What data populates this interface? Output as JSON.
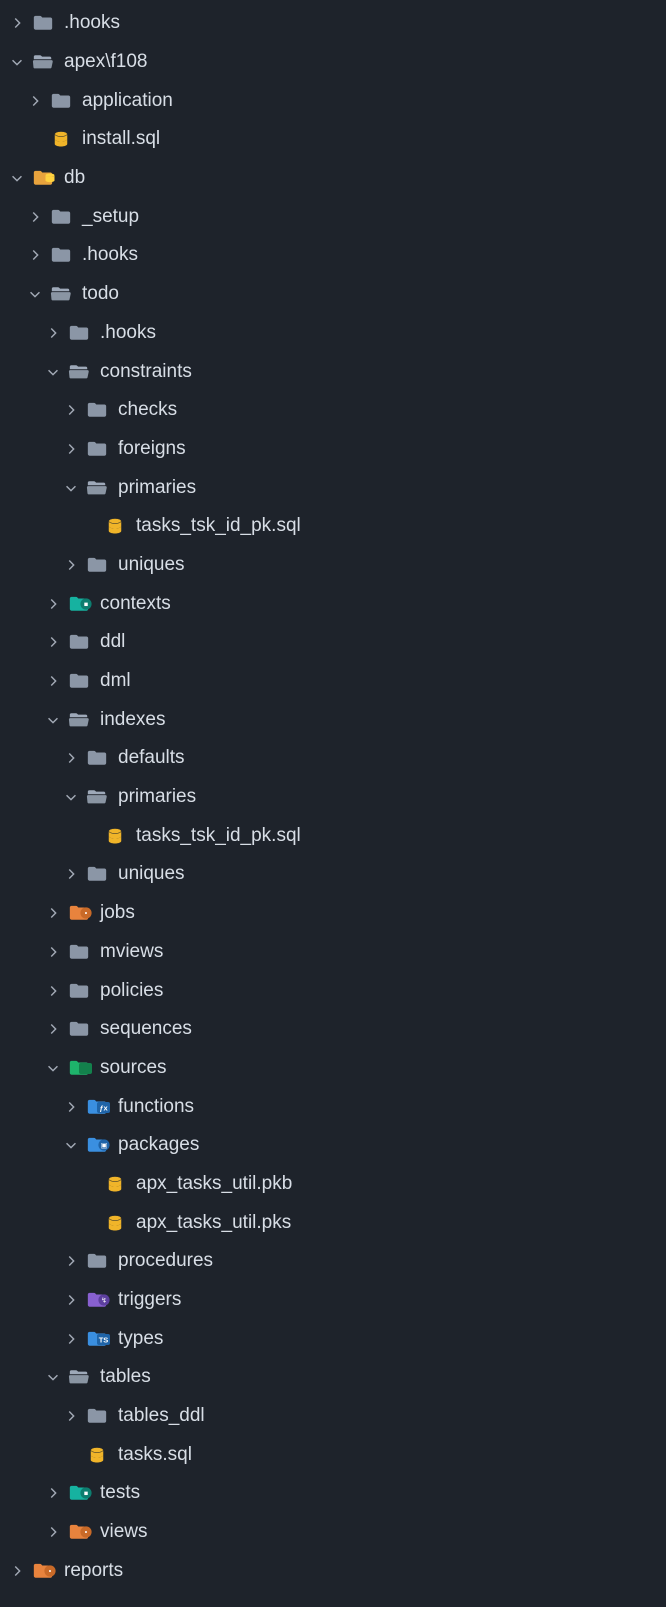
{
  "colors": {
    "folder_closed": "#8b96a6",
    "folder_open": "#9ea9b9",
    "db_yellow": "#f0b429",
    "special_folder_yellow": "#e8a33d",
    "teal": "#16b2a0",
    "orange": "#e8833d",
    "green": "#1eb36b",
    "blue": "#3a8fe0",
    "purple": "#8860d0"
  },
  "nodes": [
    {
      "depth": 0,
      "expand": "closed",
      "icon": "folder",
      "label": ".hooks"
    },
    {
      "depth": 0,
      "expand": "open",
      "icon": "folder-open",
      "label": "apex\\f108"
    },
    {
      "depth": 1,
      "expand": "closed",
      "icon": "folder",
      "label": "application"
    },
    {
      "depth": 1,
      "expand": "none",
      "icon": "db-file",
      "label": "install.sql"
    },
    {
      "depth": 0,
      "expand": "open",
      "icon": "folder-db",
      "label": "db"
    },
    {
      "depth": 1,
      "expand": "closed",
      "icon": "folder",
      "label": "_setup"
    },
    {
      "depth": 1,
      "expand": "closed",
      "icon": "folder",
      "label": ".hooks"
    },
    {
      "depth": 1,
      "expand": "open",
      "icon": "folder-open",
      "label": "todo"
    },
    {
      "depth": 2,
      "expand": "closed",
      "icon": "folder",
      "label": ".hooks"
    },
    {
      "depth": 2,
      "expand": "open",
      "icon": "folder-open",
      "label": "constraints"
    },
    {
      "depth": 3,
      "expand": "closed",
      "icon": "folder",
      "label": "checks"
    },
    {
      "depth": 3,
      "expand": "closed",
      "icon": "folder",
      "label": "foreigns"
    },
    {
      "depth": 3,
      "expand": "open",
      "icon": "folder-open",
      "label": "primaries"
    },
    {
      "depth": 4,
      "expand": "none",
      "icon": "db-file",
      "label": "tasks_tsk_id_pk.sql"
    },
    {
      "depth": 3,
      "expand": "closed",
      "icon": "folder",
      "label": "uniques"
    },
    {
      "depth": 2,
      "expand": "closed",
      "icon": "folder-teal",
      "label": "contexts"
    },
    {
      "depth": 2,
      "expand": "closed",
      "icon": "folder",
      "label": "ddl"
    },
    {
      "depth": 2,
      "expand": "closed",
      "icon": "folder",
      "label": "dml"
    },
    {
      "depth": 2,
      "expand": "open",
      "icon": "folder-open",
      "label": "indexes"
    },
    {
      "depth": 3,
      "expand": "closed",
      "icon": "folder",
      "label": "defaults"
    },
    {
      "depth": 3,
      "expand": "open",
      "icon": "folder-open",
      "label": "primaries"
    },
    {
      "depth": 4,
      "expand": "none",
      "icon": "db-file",
      "label": "tasks_tsk_id_pk.sql"
    },
    {
      "depth": 3,
      "expand": "closed",
      "icon": "folder",
      "label": "uniques"
    },
    {
      "depth": 2,
      "expand": "closed",
      "icon": "folder-orange",
      "label": "jobs"
    },
    {
      "depth": 2,
      "expand": "closed",
      "icon": "folder",
      "label": "mviews"
    },
    {
      "depth": 2,
      "expand": "closed",
      "icon": "folder",
      "label": "policies"
    },
    {
      "depth": 2,
      "expand": "closed",
      "icon": "folder",
      "label": "sequences"
    },
    {
      "depth": 2,
      "expand": "open",
      "icon": "folder-green",
      "label": "sources"
    },
    {
      "depth": 3,
      "expand": "closed",
      "icon": "folder-blue-fx",
      "label": "functions"
    },
    {
      "depth": 3,
      "expand": "open",
      "icon": "folder-blue-pkg",
      "label": "packages"
    },
    {
      "depth": 4,
      "expand": "none",
      "icon": "db-file",
      "label": "apx_tasks_util.pkb"
    },
    {
      "depth": 4,
      "expand": "none",
      "icon": "db-file",
      "label": "apx_tasks_util.pks"
    },
    {
      "depth": 3,
      "expand": "closed",
      "icon": "folder",
      "label": "procedures"
    },
    {
      "depth": 3,
      "expand": "closed",
      "icon": "folder-purple",
      "label": "triggers"
    },
    {
      "depth": 3,
      "expand": "closed",
      "icon": "folder-blue-ts",
      "label": "types"
    },
    {
      "depth": 2,
      "expand": "open",
      "icon": "folder-open",
      "label": "tables"
    },
    {
      "depth": 3,
      "expand": "closed",
      "icon": "folder",
      "label": "tables_ddl"
    },
    {
      "depth": 3,
      "expand": "none",
      "icon": "db-file",
      "label": "tasks.sql"
    },
    {
      "depth": 2,
      "expand": "closed",
      "icon": "folder-teal",
      "label": "tests"
    },
    {
      "depth": 2,
      "expand": "closed",
      "icon": "folder-orange",
      "label": "views"
    },
    {
      "depth": 0,
      "expand": "closed",
      "icon": "folder-orange",
      "label": "reports"
    }
  ]
}
